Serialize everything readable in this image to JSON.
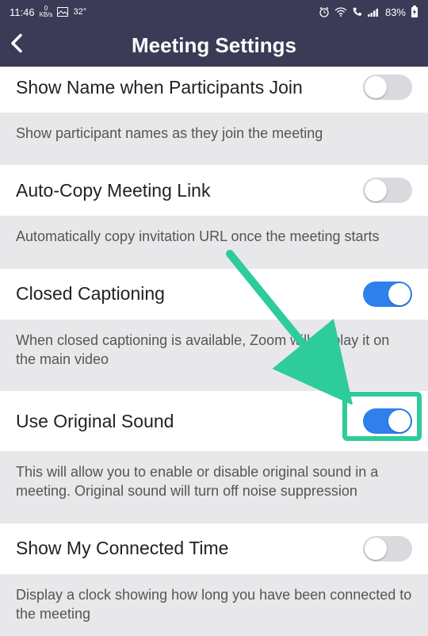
{
  "statusbar": {
    "time": "11:46",
    "net_speed_value": "0",
    "net_speed_unit": "KB/s",
    "temp": "32°",
    "battery_pct": "83%"
  },
  "header": {
    "title": "Meeting Settings"
  },
  "settings": [
    {
      "id": "show-name",
      "title": "Show Name when Participants Join",
      "desc": "Show participant names as they join the meeting",
      "on": false
    },
    {
      "id": "auto-copy",
      "title": "Auto-Copy Meeting Link",
      "desc": "Automatically copy invitation URL once the meeting starts",
      "on": false
    },
    {
      "id": "closed-caption",
      "title": "Closed Captioning",
      "desc": "When closed captioning is available, Zoom will display it on the main video",
      "on": true
    },
    {
      "id": "original-sound",
      "title": "Use Original Sound",
      "desc": "This will allow you to enable or disable original sound in a meeting. Original sound will turn off noise suppression",
      "on": true
    },
    {
      "id": "connected-time",
      "title": "Show My Connected Time",
      "desc": "Display a clock showing how long you have been connected to the meeting",
      "on": false
    }
  ],
  "annotation": {
    "highlight_target": "original-sound",
    "color": "#2ecc9a"
  }
}
